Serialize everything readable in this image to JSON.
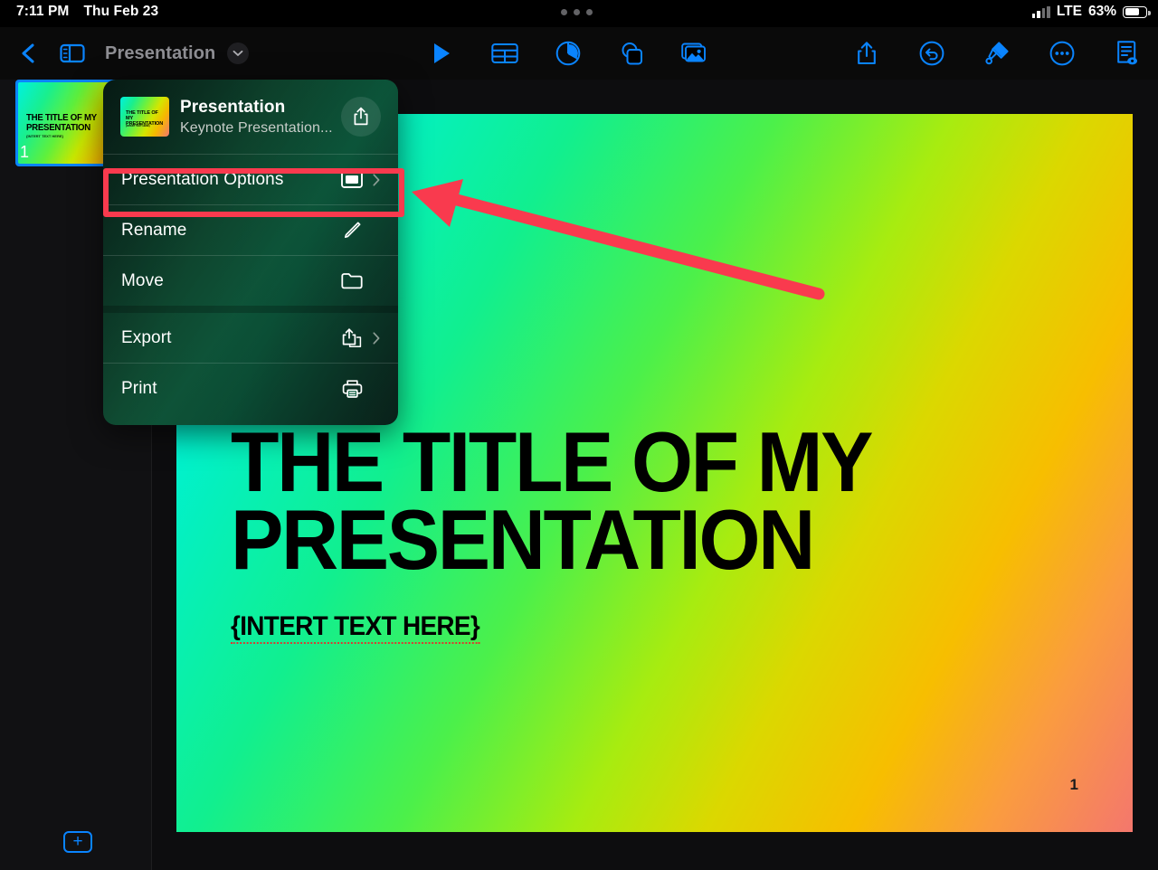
{
  "status_bar": {
    "time": "7:11 PM",
    "date": "Thu Feb 23",
    "carrier": "LTE",
    "battery_percent": "63%",
    "battery_level": 63,
    "signal_icon": "cellular-signal-icon",
    "multitask_icon": "multitasking-handle-icon"
  },
  "toolbar": {
    "back_icon": "chevron-left-icon",
    "sidebar_icon": "sidebar-toggle-icon",
    "document_title": "Presentation",
    "title_chevron_icon": "chevron-down-icon",
    "center_tools": [
      {
        "name": "play-button",
        "icon": "play-icon"
      },
      {
        "name": "insert-table-button",
        "icon": "table-icon"
      },
      {
        "name": "insert-chart-button",
        "icon": "pie-chart-icon"
      },
      {
        "name": "insert-shape-button",
        "icon": "shapes-icon"
      },
      {
        "name": "insert-media-button",
        "icon": "media-image-icon"
      }
    ],
    "right_tools": [
      {
        "name": "share-button",
        "icon": "share-icon"
      },
      {
        "name": "undo-button",
        "icon": "undo-icon"
      },
      {
        "name": "format-button",
        "icon": "paintbrush-icon"
      },
      {
        "name": "more-button",
        "icon": "ellipsis-circle-icon"
      },
      {
        "name": "presenter-notes-button",
        "icon": "document-view-icon"
      }
    ]
  },
  "sidebar": {
    "slides": [
      {
        "number": "1",
        "title": "THE TITLE OF MY PRESENTATION",
        "subtitle": "{INTERT TEXT HERE}",
        "selected": true
      }
    ],
    "add_slide_label": "+"
  },
  "popover": {
    "title": "Presentation",
    "subtitle": "Keynote Presentation...",
    "thumbnail_title": "THE TITLE OF MY PRESENTATION",
    "thumbnail_subtitle": "{INTERT TEXT HERE}",
    "share_icon": "share-icon",
    "items": [
      {
        "label": "Presentation Options",
        "icon": "display-screen-icon",
        "has_chevron": true,
        "highlighted": true
      },
      {
        "label": "Rename",
        "icon": "pencil-icon",
        "has_chevron": false,
        "highlighted": false
      },
      {
        "label": "Move",
        "icon": "folder-icon",
        "has_chevron": false,
        "highlighted": false
      },
      {
        "label": "Export",
        "icon": "export-icon",
        "has_chevron": true,
        "highlighted": false
      },
      {
        "label": "Print",
        "icon": "printer-icon",
        "has_chevron": false,
        "highlighted": false
      }
    ]
  },
  "slide": {
    "title": "THE TITLE OF MY PRESENTATION",
    "subtitle": "{INTERT TEXT HERE}",
    "page_number": "1",
    "spellcheck_word": "INTERT"
  },
  "annotation": {
    "color": "#f93a4e",
    "highlight_target": "Presentation Options",
    "arrow_icon": "pointer-arrow-icon"
  },
  "colors": {
    "accent_blue": "#0a84ff",
    "annotation_red": "#f93a4e",
    "menu_green": "#125a3c",
    "slide_gradient_start": "#00f5e2",
    "slide_gradient_end": "#f4776d"
  }
}
